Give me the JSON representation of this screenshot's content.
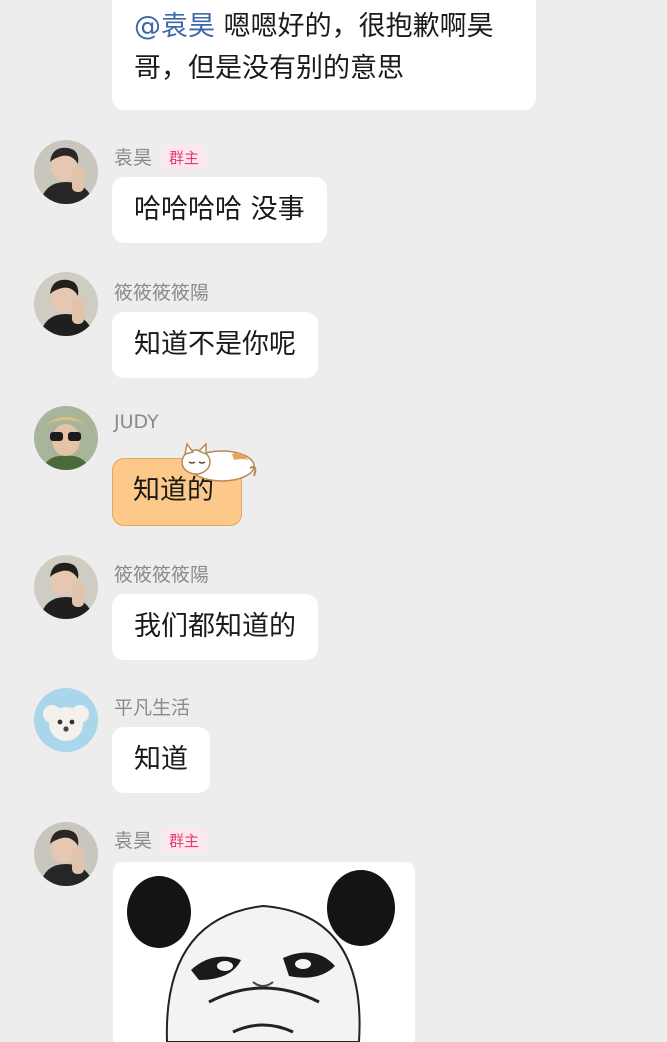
{
  "messages": [
    {
      "mention": "@袁昊",
      "line1": "嗯嗯好的，很抱歉啊昊",
      "line2": "哥，但是没有别的意思"
    },
    {
      "sender": "袁昊",
      "badge": "群主",
      "text": "哈哈哈哈 没事",
      "avatar_icon": "man-avatar-icon"
    },
    {
      "sender": "筱筱筱筱陽",
      "text": "知道不是你呢",
      "avatar_icon": "man-avatar-icon"
    },
    {
      "sender": "JUDY",
      "text": "知道的",
      "avatar_icon": "sunglasses-avatar-icon",
      "bubble_color": "#fcc98a",
      "decoration_icon": "sleeping-cat-icon"
    },
    {
      "sender": "筱筱筱筱陽",
      "text": "我们都知道的",
      "avatar_icon": "man-avatar-icon"
    },
    {
      "sender": "平凡生活",
      "text": "知道",
      "avatar_icon": "puppy-avatar-icon"
    },
    {
      "sender": "袁昊",
      "badge": "群主",
      "avatar_icon": "man-avatar-icon",
      "sticker_icon": "panda-meme-sticker-icon"
    }
  ],
  "colors": {
    "background": "#ededed",
    "bubble": "#ffffff",
    "mention": "#3d68a8",
    "sender_name": "#8a8a8a",
    "badge_text": "#e23e6b",
    "badge_bg": "#fde7ee"
  }
}
